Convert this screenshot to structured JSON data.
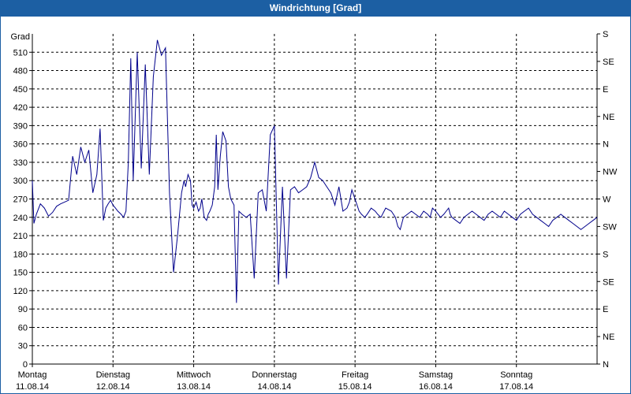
{
  "chart_data": {
    "type": "line",
    "title": "Windrichtung [Grad]",
    "ylabel": "Grad",
    "ylim": [
      0,
      540
    ],
    "yticks": [
      0,
      30,
      60,
      90,
      120,
      150,
      180,
      210,
      240,
      270,
      300,
      330,
      360,
      390,
      420,
      450,
      480,
      510
    ],
    "right_axis_labels": [
      {
        "value": 0,
        "label": "N"
      },
      {
        "value": 45,
        "label": "NE"
      },
      {
        "value": 90,
        "label": "E"
      },
      {
        "value": 135,
        "label": "SE"
      },
      {
        "value": 180,
        "label": "S"
      },
      {
        "value": 225,
        "label": "SW"
      },
      {
        "value": 270,
        "label": "W"
      },
      {
        "value": 315,
        "label": "NW"
      },
      {
        "value": 360,
        "label": "N"
      },
      {
        "value": 405,
        "label": "NE"
      },
      {
        "value": 450,
        "label": "E"
      },
      {
        "value": 495,
        "label": "SE"
      },
      {
        "value": 540,
        "label": "S"
      }
    ],
    "xlim": [
      0,
      7
    ],
    "days": [
      {
        "x": 0,
        "day": "Montag",
        "date": "11.08.14"
      },
      {
        "x": 1,
        "day": "Dienstag",
        "date": "12.08.14"
      },
      {
        "x": 2,
        "day": "Mittwoch",
        "date": "13.08.14"
      },
      {
        "x": 3,
        "day": "Donnerstag",
        "date": "14.08.14"
      },
      {
        "x": 4,
        "day": "Freitag",
        "date": "15.08.14"
      },
      {
        "x": 5,
        "day": "Samstag",
        "date": "16.08.14"
      },
      {
        "x": 6,
        "day": "Sonntag",
        "date": "17.08.14"
      }
    ],
    "grid": true,
    "line_color": "#00008b",
    "series": [
      {
        "x": [
          0,
          0.02,
          0.05,
          0.1,
          0.15,
          0.2,
          0.25,
          0.3,
          0.35,
          0.4,
          0.45,
          0.5,
          0.55,
          0.6,
          0.65,
          0.7,
          0.75,
          0.8,
          0.84,
          0.88,
          0.91,
          0.94,
          0.97,
          1.0,
          1.03,
          1.06,
          1.1,
          1.13,
          1.16,
          1.19,
          1.22,
          1.25,
          1.3,
          1.35,
          1.4,
          1.45,
          1.5,
          1.55,
          1.6,
          1.65,
          1.7,
          1.75,
          1.8,
          1.85,
          1.88,
          1.9,
          1.93,
          1.96,
          1.98,
          2.0,
          2.03,
          2.06,
          2.08,
          2.1,
          2.13,
          2.16,
          2.18,
          2.2,
          2.23,
          2.26,
          2.28,
          2.3,
          2.33,
          2.36,
          2.4,
          2.43,
          2.46,
          2.5,
          2.53,
          2.56,
          2.6,
          2.65,
          2.7,
          2.75,
          2.8,
          2.85,
          2.9,
          2.95,
          3.0,
          3.05,
          3.1,
          3.15,
          3.2,
          3.25,
          3.3,
          3.35,
          3.4,
          3.45,
          3.5,
          3.55,
          3.6,
          3.65,
          3.7,
          3.75,
          3.8,
          3.85,
          3.9,
          3.93,
          3.96,
          4.0,
          4.05,
          4.08,
          4.12,
          4.15,
          4.2,
          4.25,
          4.28,
          4.32,
          4.38,
          4.45,
          4.5,
          4.53,
          4.56,
          4.6,
          4.65,
          4.7,
          4.75,
          4.8,
          4.85,
          4.9,
          4.93,
          4.96,
          5.0,
          5.03,
          5.06,
          5.1,
          5.13,
          5.16,
          5.18,
          5.2,
          5.25,
          5.3,
          5.35,
          5.4,
          5.45,
          5.5,
          5.55,
          5.6,
          5.65,
          5.7,
          5.75,
          5.8,
          5.85,
          5.9,
          5.95,
          6.0,
          6.05,
          6.1,
          6.15,
          6.2,
          6.25,
          6.3,
          6.35,
          6.4,
          6.45,
          6.5,
          6.55,
          6.6,
          6.65,
          6.7,
          6.75,
          6.8,
          6.85,
          6.9,
          6.95,
          7.0
        ],
        "values": [
          300,
          230,
          245,
          262,
          255,
          242,
          248,
          258,
          262,
          265,
          268,
          340,
          310,
          355,
          330,
          350,
          280,
          310,
          385,
          235,
          255,
          262,
          268,
          260,
          255,
          250,
          245,
          240,
          250,
          330,
          500,
          300,
          510,
          320,
          490,
          310,
          470,
          530,
          505,
          517,
          280,
          150,
          210,
          280,
          300,
          290,
          310,
          300,
          260,
          255,
          265,
          250,
          255,
          270,
          240,
          235,
          245,
          250,
          260,
          290,
          375,
          285,
          340,
          380,
          365,
          290,
          270,
          260,
          100,
          250,
          245,
          240,
          245,
          140,
          280,
          285,
          250,
          375,
          390,
          130,
          290,
          140,
          285,
          290,
          280,
          285,
          290,
          305,
          330,
          305,
          300,
          290,
          280,
          260,
          290,
          250,
          255,
          265,
          285,
          270,
          250,
          245,
          240,
          245,
          255,
          250,
          245,
          240,
          255,
          250,
          240,
          225,
          220,
          240,
          245,
          250,
          245,
          240,
          250,
          245,
          240,
          255,
          250,
          245,
          240,
          245,
          250,
          255,
          245,
          240,
          235,
          230,
          240,
          245,
          250,
          245,
          240,
          235,
          245,
          250,
          245,
          240,
          250,
          245,
          240,
          235,
          245,
          250,
          255,
          245,
          240,
          235,
          230,
          225,
          235,
          240,
          245,
          240,
          235,
          230,
          225,
          220,
          225,
          230,
          235,
          240
        ]
      }
    ]
  }
}
